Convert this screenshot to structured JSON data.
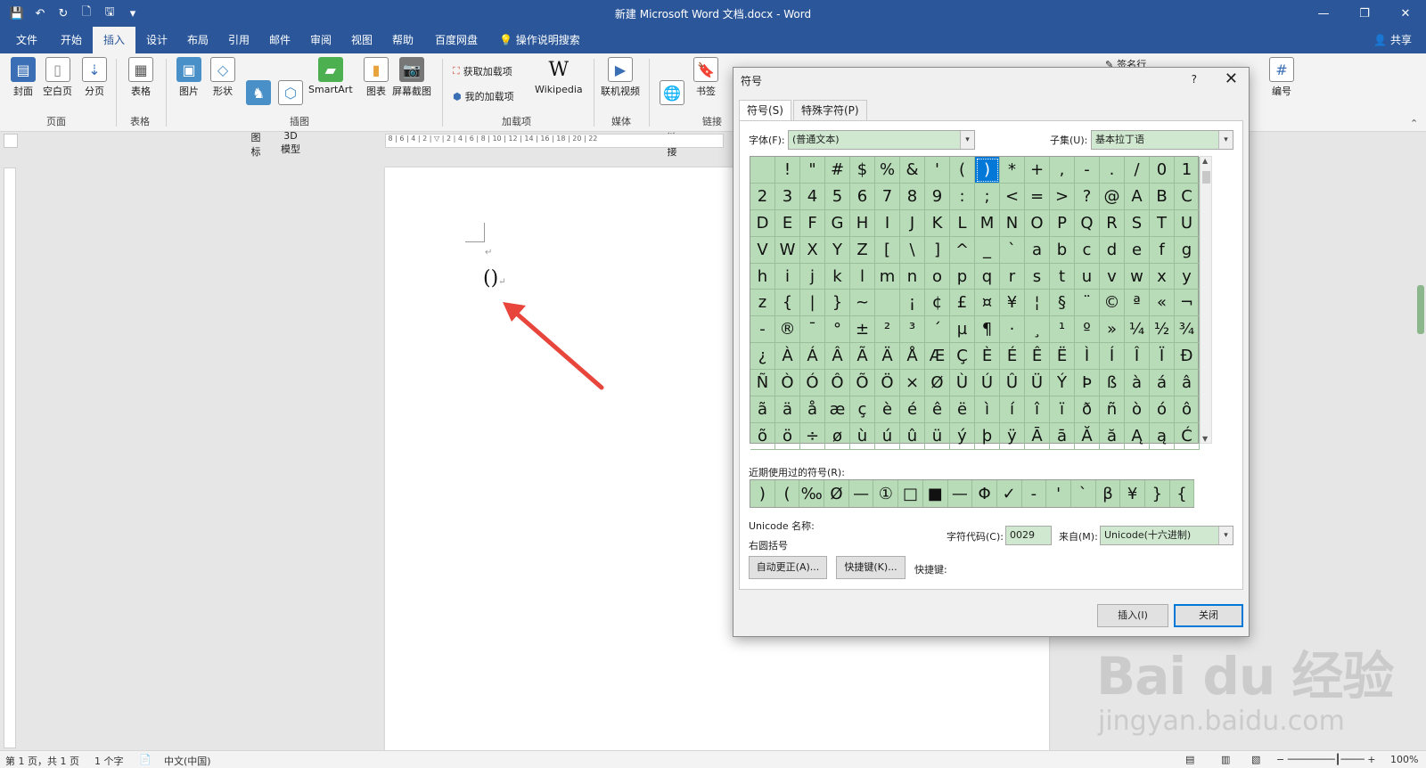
{
  "window": {
    "title": "新建 Microsoft Word 文档.docx  -  Word",
    "minimize": "—",
    "restore": "❐",
    "close": "✕"
  },
  "quick_access": [
    "💾",
    "↶",
    "↻",
    "🗋",
    "🖫",
    "▾"
  ],
  "tabs": [
    {
      "label": "文件"
    },
    {
      "label": "开始"
    },
    {
      "label": "插入"
    },
    {
      "label": "设计"
    },
    {
      "label": "布局"
    },
    {
      "label": "引用"
    },
    {
      "label": "邮件"
    },
    {
      "label": "审阅"
    },
    {
      "label": "视图"
    },
    {
      "label": "帮助"
    },
    {
      "label": "百度网盘"
    }
  ],
  "tell_me": "操作说明搜索",
  "share": "共享",
  "ribbon": {
    "cover": "封面",
    "blank_page": "空白页",
    "page_break": "分页",
    "group_pages": "页面",
    "table": "表格",
    "group_table": "表格",
    "pictures": "图片",
    "shapes": "形状",
    "icons": "图\n标",
    "model3d": "3D\n模型",
    "smartart": "SmartArt",
    "chart": "图表",
    "screenshot": "屏幕截图",
    "group_illustrations": "插图",
    "get_addins": "获取加载项",
    "my_addins": "我的加载项",
    "wikipedia": "Wikipedia",
    "group_addins": "加载项",
    "online_video": "联机视频",
    "group_media": "媒体",
    "link": "链\n接",
    "bookmark": "书签",
    "group_links": "链接",
    "numbering": "编号",
    "signature": "签名行"
  },
  "document": {
    "content": "()",
    "para_mark": "↵"
  },
  "dialog": {
    "title": "符号",
    "help": "?",
    "close": "✕",
    "tab_symbols": "符号(S)",
    "tab_special": "特殊字符(P)",
    "font_label": "字体(F):",
    "font_value": "(普通文本)",
    "subset_label": "子集(U):",
    "subset_value": "基本拉丁语",
    "symbols": [
      " ",
      "!",
      "\"",
      "#",
      "$",
      "%",
      "&",
      "'",
      "(",
      ")",
      "*",
      "+",
      ",",
      "-",
      ".",
      "/",
      "0",
      "1",
      "2",
      "3",
      "4",
      "5",
      "6",
      "7",
      "8",
      "9",
      ":",
      ";",
      "<",
      "=",
      ">",
      "?",
      "@",
      "A",
      "B",
      "C",
      "D",
      "E",
      "F",
      "G",
      "H",
      "I",
      "J",
      "K",
      "L",
      "M",
      "N",
      "O",
      "P",
      "Q",
      "R",
      "S",
      "T",
      "U",
      "V",
      "W",
      "X",
      "Y",
      "Z",
      "[",
      "\\",
      "]",
      "^",
      "_",
      "`",
      "a",
      "b",
      "c",
      "d",
      "e",
      "f",
      "g",
      "h",
      "i",
      "j",
      "k",
      "l",
      "m",
      "n",
      "o",
      "p",
      "q",
      "r",
      "s",
      "t",
      "u",
      "v",
      "w",
      "x",
      "y",
      "z",
      "{",
      "|",
      "}",
      "~",
      " ",
      "¡",
      "¢",
      "£",
      "¤",
      "¥",
      "¦",
      "§",
      "¨",
      "©",
      "ª",
      "«",
      "¬",
      "-",
      "®",
      "¯",
      "°",
      "±",
      "²",
      "³",
      "´",
      "µ",
      "¶",
      "·",
      "¸",
      "¹",
      "º",
      "»",
      "¼",
      "½",
      "¾",
      "¿",
      "À",
      "Á",
      "Â",
      "Ã",
      "Ä",
      "Å",
      "Æ",
      "Ç",
      "È",
      "É",
      "Ê",
      "Ë",
      "Ì",
      "Í",
      "Î",
      "Ï",
      "Ð",
      "Ñ",
      "Ò",
      "Ó",
      "Ô",
      "Õ",
      "Ö",
      "×",
      "Ø",
      "Ù",
      "Ú",
      "Û",
      "Ü",
      "Ý",
      "Þ",
      "ß",
      "à",
      "á",
      "â",
      "ã",
      "ä",
      "å",
      "æ",
      "ç",
      "è",
      "é",
      "ê",
      "ë",
      "ì",
      "í",
      "î",
      "ï",
      "ð",
      "ñ",
      "ò",
      "ó",
      "ô",
      "õ",
      "ö",
      "÷",
      "ø",
      "ù",
      "ú",
      "û",
      "ü",
      "ý",
      "þ",
      "ÿ",
      "Ā",
      "ā",
      "Ă",
      "ă",
      "Ą",
      "ą",
      "Ć"
    ],
    "selected_index": 9,
    "recent_label": "近期使用过的符号(R):",
    "recent": [
      ")",
      "(",
      "‰",
      "Ø",
      "—",
      "①",
      "□",
      "■",
      "—",
      "Φ",
      "✓",
      "-",
      "'",
      "`",
      "β",
      "¥",
      "}",
      "{"
    ],
    "unicode_name_label": "Unicode 名称:",
    "unicode_name_value": "右圆括号",
    "char_code_label": "字符代码(C):",
    "char_code_value": "0029",
    "from_label": "来自(M):",
    "from_value": "Unicode(十六进制)",
    "autocorrect_button": "自动更正(A)...",
    "shortcut_button": "快捷键(K)...",
    "shortcut_label": "快捷键:",
    "insert_button": "插入(I)",
    "close_button": "关闭"
  },
  "statusbar": {
    "page": "第 1 页，共 1 页",
    "words": "1 个字",
    "language": "中文(中国)",
    "zoom": "100%"
  },
  "watermark": {
    "brand": "Bai du 经验",
    "url": "jingyan.baidu.com"
  },
  "colors": {
    "accent": "#2b579a",
    "grid_bg": "#b8dcb8",
    "selection": "#0078d7",
    "arrow": "#e8453c"
  }
}
